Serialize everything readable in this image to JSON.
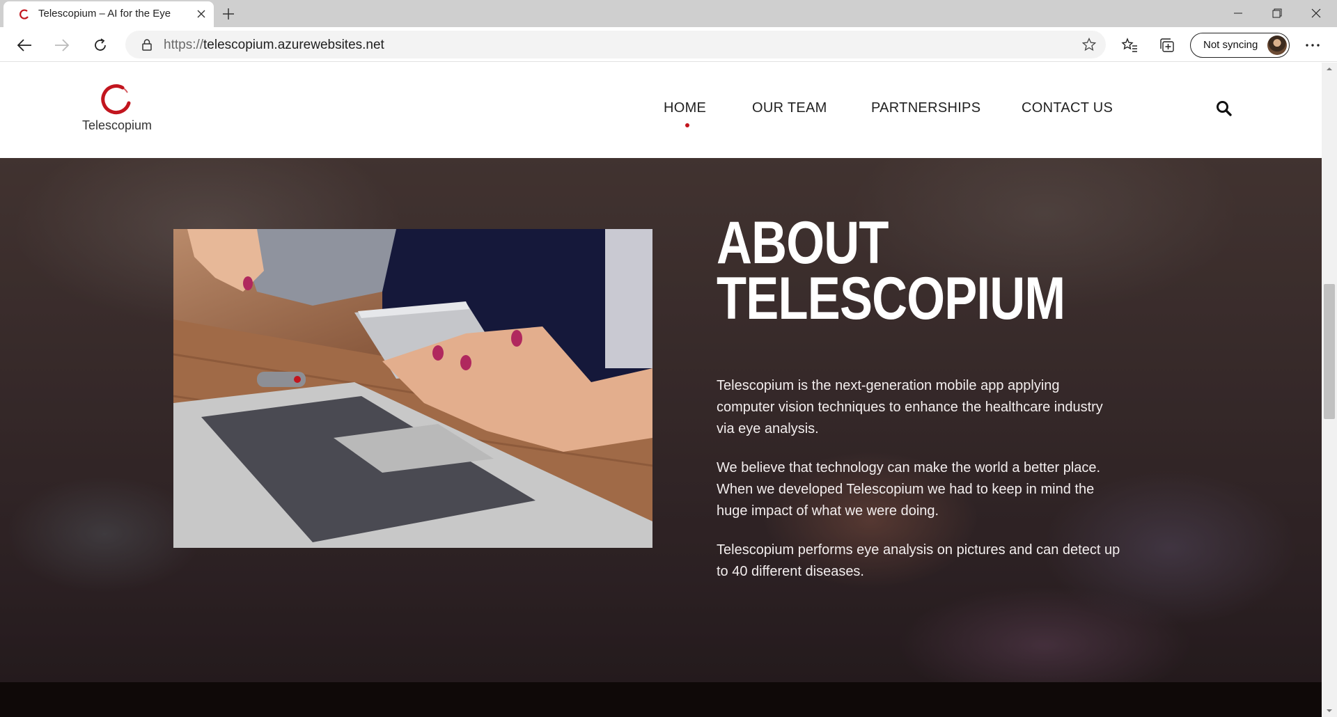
{
  "browser": {
    "tab": {
      "title": "Telescopium – AI for the Eye"
    },
    "address": {
      "url_protocol": "https://",
      "url_host": "telescopium.azurewebsites.net"
    },
    "profile": {
      "sync_label": "Not syncing"
    },
    "icons": [
      "telescopium-favicon",
      "close-icon",
      "plus-icon",
      "minimize-icon",
      "restore-icon",
      "window-close-icon",
      "back-arrow-icon",
      "forward-arrow-icon",
      "refresh-icon",
      "lock-icon",
      "star-icon",
      "favorites-icon",
      "collections-icon",
      "more-icon"
    ]
  },
  "site": {
    "logo_text": "Telescopium",
    "brand_color": "#c2151e",
    "nav": [
      {
        "label": "HOME",
        "active": true
      },
      {
        "label": "OUR TEAM",
        "active": false
      },
      {
        "label": "PARTNERSHIPS",
        "active": false
      },
      {
        "label": "CONTACT US",
        "active": false
      }
    ],
    "search_icon": "search-icon"
  },
  "about": {
    "title_line1": "ABOUT",
    "title_line2": "TELESCOPIUM",
    "paragraphs": [
      "Telescopium is the next-generation mobile app applying computer vision techniques to enhance the healthcare industry via eye analysis.",
      "We believe that technology can make the world a better place. When we developed Telescopium we had to keep in mind the huge impact of what we were doing.",
      "Telescopium performs eye analysis on pictures and can detect up to 40 different diseases."
    ]
  }
}
